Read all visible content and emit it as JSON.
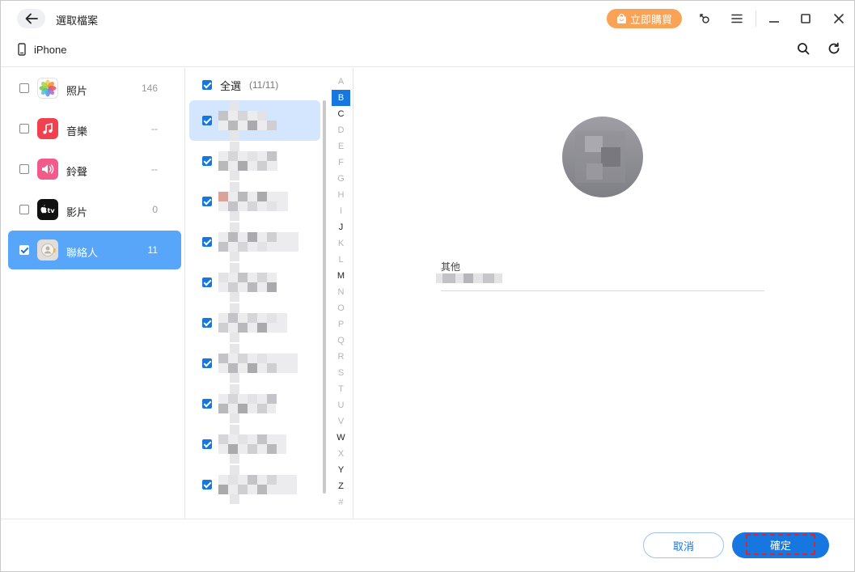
{
  "window": {
    "title": "選取檔案",
    "buy_label": "立即購買",
    "device_name": "iPhone"
  },
  "icons": {
    "back": "arrow-left-icon",
    "buy": "shopping-bag-icon",
    "feedback": "key-icon",
    "menu": "hamburger-menu-icon",
    "minimize": "minimize-icon",
    "maximize": "maximize-icon",
    "close": "close-icon",
    "device": "phone-icon",
    "search": "search-icon",
    "refresh": "refresh-icon"
  },
  "categories": [
    {
      "label": "照片",
      "count": "146",
      "checked": false,
      "active": false,
      "icon": "photos-icon",
      "color": "#ffffff"
    },
    {
      "label": "音樂",
      "count": "--",
      "checked": false,
      "active": false,
      "icon": "music-icon",
      "color": "#f2414e"
    },
    {
      "label": "鈴聲",
      "count": "--",
      "checked": false,
      "active": false,
      "icon": "ringtone-icon",
      "color": "#f25a8a"
    },
    {
      "label": "影片",
      "count": "0",
      "checked": false,
      "active": false,
      "icon": "apple-tv-icon",
      "color": "#111111"
    },
    {
      "label": "聯絡人",
      "count": "11",
      "checked": true,
      "active": true,
      "icon": "contacts-icon",
      "color": "#e2ddd8"
    }
  ],
  "contacts": {
    "select_all_label": "全選",
    "select_all_count": "(11/11)",
    "select_all_checked": true,
    "rows": [
      {
        "checked": true,
        "active": true
      },
      {
        "checked": true,
        "active": false
      },
      {
        "checked": true,
        "active": false
      },
      {
        "checked": true,
        "active": false
      },
      {
        "checked": true,
        "active": false
      },
      {
        "checked": true,
        "active": false
      },
      {
        "checked": true,
        "active": false
      },
      {
        "checked": true,
        "active": false
      },
      {
        "checked": true,
        "active": false
      },
      {
        "checked": true,
        "active": false
      }
    ]
  },
  "alphabet": [
    {
      "letter": "A",
      "has": false,
      "active": false
    },
    {
      "letter": "B",
      "has": true,
      "active": true
    },
    {
      "letter": "C",
      "has": true,
      "active": false
    },
    {
      "letter": "D",
      "has": false,
      "active": false
    },
    {
      "letter": "E",
      "has": false,
      "active": false
    },
    {
      "letter": "F",
      "has": false,
      "active": false
    },
    {
      "letter": "G",
      "has": false,
      "active": false
    },
    {
      "letter": "H",
      "has": false,
      "active": false
    },
    {
      "letter": "I",
      "has": false,
      "active": false
    },
    {
      "letter": "J",
      "has": true,
      "active": false
    },
    {
      "letter": "K",
      "has": false,
      "active": false
    },
    {
      "letter": "L",
      "has": false,
      "active": false
    },
    {
      "letter": "M",
      "has": true,
      "active": false
    },
    {
      "letter": "N",
      "has": false,
      "active": false
    },
    {
      "letter": "O",
      "has": false,
      "active": false
    },
    {
      "letter": "P",
      "has": false,
      "active": false
    },
    {
      "letter": "Q",
      "has": false,
      "active": false
    },
    {
      "letter": "R",
      "has": false,
      "active": false
    },
    {
      "letter": "S",
      "has": false,
      "active": false
    },
    {
      "letter": "T",
      "has": false,
      "active": false
    },
    {
      "letter": "U",
      "has": false,
      "active": false
    },
    {
      "letter": "V",
      "has": false,
      "active": false
    },
    {
      "letter": "W",
      "has": true,
      "active": false
    },
    {
      "letter": "X",
      "has": false,
      "active": false
    },
    {
      "letter": "Y",
      "has": true,
      "active": false
    },
    {
      "letter": "Z",
      "has": true,
      "active": false
    },
    {
      "letter": "#",
      "has": false,
      "active": false
    }
  ],
  "detail": {
    "field_label": "其他"
  },
  "footer": {
    "cancel_label": "取消",
    "ok_label": "確定"
  },
  "colors": {
    "accent": "#1677e0",
    "active_category": "#57a6f9",
    "active_contact": "#d3e6fd",
    "buy_button": "#f8a355",
    "highlight_border": "#e0222c"
  }
}
